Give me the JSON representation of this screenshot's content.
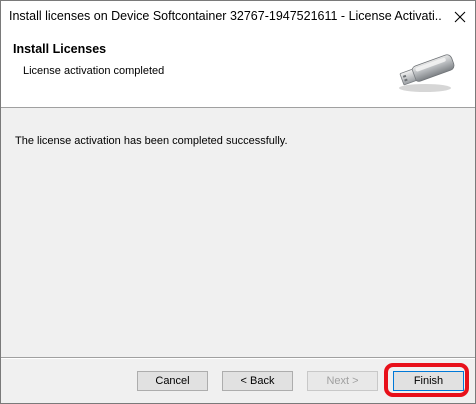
{
  "window": {
    "title": "Install licenses on Device Softcontainer 32767-1947521611 - License Activati..."
  },
  "header": {
    "title": "Install Licenses",
    "subtitle": "License activation completed",
    "icon": "usb-dongle-icon"
  },
  "body": {
    "message": "The license activation has been completed successfully."
  },
  "buttons": {
    "cancel": "Cancel",
    "back": "< Back",
    "next": "Next >",
    "finish": "Finish"
  },
  "colors": {
    "highlight": "#e8101a",
    "panel_background": "#f0f0f0",
    "header_background": "#ffffff"
  }
}
